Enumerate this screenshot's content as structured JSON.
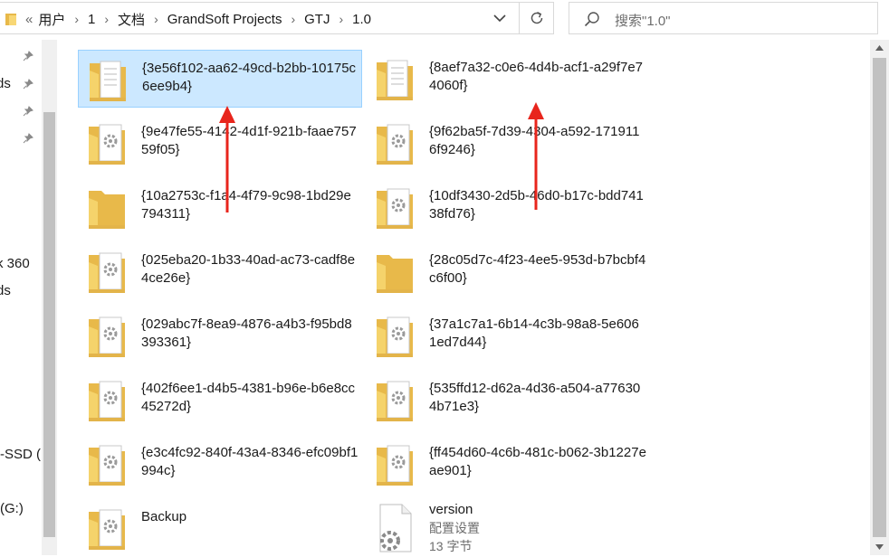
{
  "address": {
    "overflow": "«",
    "crumbs": [
      "用户",
      "1",
      "文档",
      "GrandSoft Projects",
      "GTJ",
      "1.0"
    ],
    "separator": "›"
  },
  "search": {
    "placeholder": "搜索\"1.0\""
  },
  "nav": {
    "items": [
      "ds",
      "k 360",
      "ds",
      "-SSD (",
      "(G:)"
    ]
  },
  "files": [
    {
      "name": "{3e56f102-aa62-49cd-b2bb-10175c6ee9b4}",
      "icon": "folder-with-documents",
      "selected": true
    },
    {
      "name": "{8aef7a32-c0e6-4d4b-acf1-a29f7e74060f}",
      "icon": "folder-with-documents",
      "selected": false
    },
    {
      "name": "{9e47fe55-4142-4d1f-921b-faae75759f05}",
      "icon": "folder-with-settings",
      "selected": false
    },
    {
      "name": "{9f62ba5f-7d39-4304-a592-1719116f9246}",
      "icon": "folder-with-settings",
      "selected": false
    },
    {
      "name": "{10a2753c-f1a4-4f79-9c98-1bd29e794311}",
      "icon": "empty-folder",
      "selected": false
    },
    {
      "name": "{10df3430-2d5b-46d0-b17c-bdd74138fd76}",
      "icon": "folder-with-settings",
      "selected": false
    },
    {
      "name": "{025eba20-1b33-40ad-ac73-cadf8e4ce26e}",
      "icon": "folder-with-settings",
      "selected": false
    },
    {
      "name": "{28c05d7c-4f23-4ee5-953d-b7bcbf4c6f00}",
      "icon": "empty-folder",
      "selected": false
    },
    {
      "name": "{029abc7f-8ea9-4876-a4b3-f95bd8393361}",
      "icon": "folder-with-settings",
      "selected": false
    },
    {
      "name": "{37a1c7a1-6b14-4c3b-98a8-5e6061ed7d44}",
      "icon": "folder-with-settings",
      "selected": false
    },
    {
      "name": "{402f6ee1-d4b5-4381-b96e-b6e8cc45272d}",
      "icon": "folder-with-settings",
      "selected": false
    },
    {
      "name": "{535ffd12-d62a-4d36-a504-a776304b71e3}",
      "icon": "folder-with-settings",
      "selected": false
    },
    {
      "name": "{e3c4fc92-840f-43a4-8346-efc09bf1994c}",
      "icon": "folder-with-settings",
      "selected": false
    },
    {
      "name": "{ff454d60-4c6b-481c-b062-3b1227eae901}",
      "icon": "folder-with-settings",
      "selected": false
    },
    {
      "name": "Backup",
      "icon": "folder-with-settings",
      "selected": false
    },
    {
      "name": "version",
      "icon": "config-file",
      "selected": false,
      "type": "配置设置",
      "size": "13 字节"
    }
  ],
  "colors": {
    "selection_bg": "#cce8ff",
    "selection_border": "#99d1ff",
    "folder": "#f5d36b",
    "annotation_arrow": "#e8251c"
  }
}
